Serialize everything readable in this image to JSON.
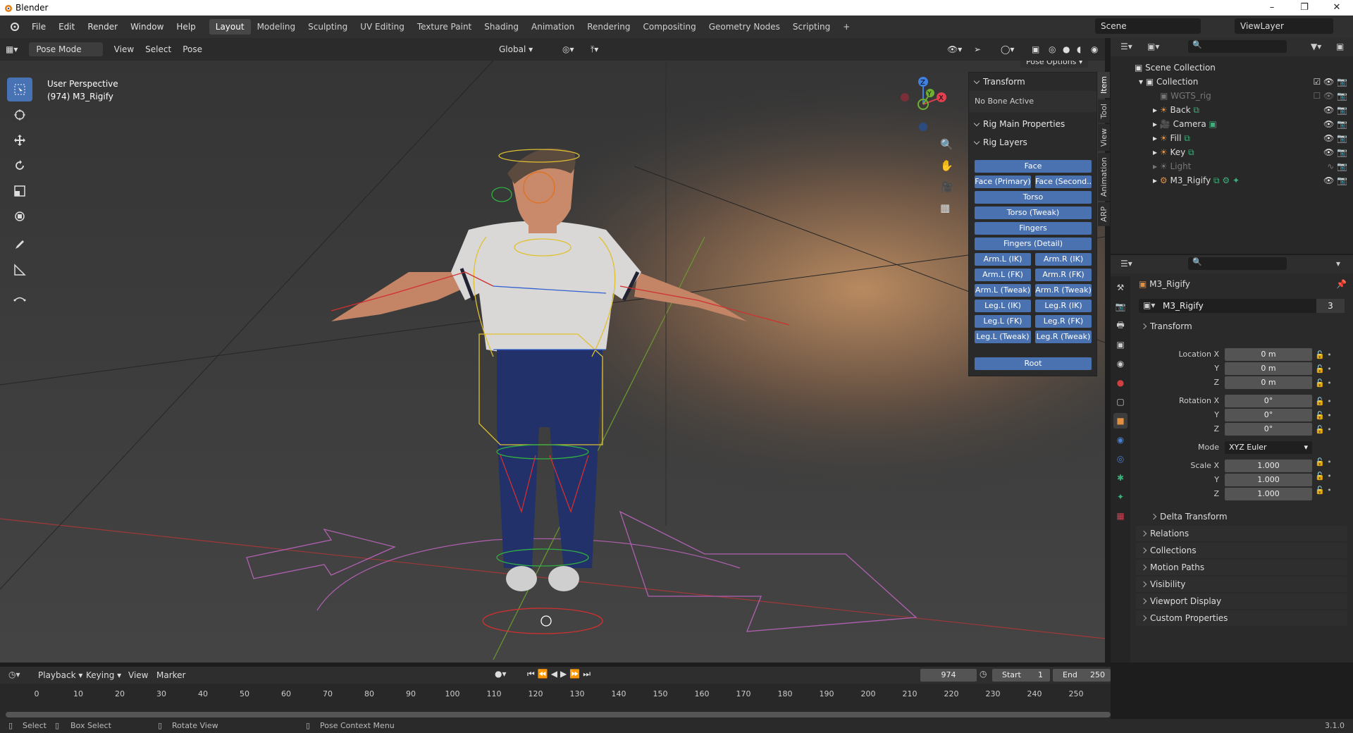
{
  "window": {
    "title": "Blender"
  },
  "topbar": {
    "menus": [
      "File",
      "Edit",
      "Render",
      "Window",
      "Help"
    ],
    "workspaces": [
      "Layout",
      "Modeling",
      "Sculpting",
      "UV Editing",
      "Texture Paint",
      "Shading",
      "Animation",
      "Rendering",
      "Compositing",
      "Geometry Nodes",
      "Scripting"
    ],
    "add_workspace": "+",
    "scene": "Scene",
    "view_layer": "ViewLayer"
  },
  "viewport_header": {
    "mode": "Pose Mode",
    "menus": [
      "View",
      "Select",
      "Pose"
    ],
    "orientation": "Global",
    "pose_options": "Pose Options"
  },
  "viewport": {
    "view_name": "User Perspective",
    "object_info": "(974) M3_Rigify",
    "gizmo_axes": [
      "X",
      "Y",
      "Z"
    ]
  },
  "npanel": {
    "tabs": [
      "Item",
      "Tool",
      "View",
      "Animation",
      "ARP"
    ],
    "transform": "Transform",
    "no_bone": "No Bone Active",
    "rig_main": "Rig Main Properties",
    "rig_layers": "Rig Layers",
    "layers": [
      "Face",
      "Face (Primary)",
      "Face (Second...",
      "Torso",
      "Torso (Tweak)",
      "Fingers",
      "Fingers (Detail)",
      "Arm.L (IK)",
      "Arm.R (IK)",
      "Arm.L (FK)",
      "Arm.R (FK)",
      "Arm.L (Tweak)",
      "Arm.R (Tweak)",
      "Leg.L (IK)",
      "Leg.R (IK)",
      "Leg.L (FK)",
      "Leg.R (FK)",
      "Leg.L (Tweak)",
      "Leg.R (Tweak)",
      "Root"
    ]
  },
  "outliner": {
    "root": "Scene Collection",
    "collection": "Collection",
    "items": [
      "WGTS_rig",
      "Back",
      "Camera",
      "Fill",
      "Key",
      "Light",
      "M3_Rigify"
    ]
  },
  "properties": {
    "object_name": "M3_Rigify",
    "datablock": "M3_Rigify",
    "users": "3",
    "transform_label": "Transform",
    "location_label": "Location X",
    "loc": [
      "0 m",
      "0 m",
      "0 m"
    ],
    "rotation_label": "Rotation X",
    "rot": [
      "0°",
      "0°",
      "0°"
    ],
    "axis_y": "Y",
    "axis_z": "Z",
    "mode_label": "Mode",
    "mode": "XYZ Euler",
    "scale_label": "Scale X",
    "scale": [
      "1.000",
      "1.000",
      "1.000"
    ],
    "delta": "Delta Transform",
    "sections": [
      "Relations",
      "Collections",
      "Motion Paths",
      "Visibility",
      "Viewport Display",
      "Custom Properties"
    ]
  },
  "timeline": {
    "menus": [
      "Playback",
      "Keying",
      "View",
      "Marker"
    ],
    "current_frame": "974",
    "start_label": "Start",
    "start": "1",
    "end_label": "End",
    "end": "250",
    "ticks": [
      "0",
      "10",
      "20",
      "30",
      "40",
      "50",
      "60",
      "70",
      "80",
      "90",
      "100",
      "110",
      "120",
      "130",
      "140",
      "150",
      "160",
      "170",
      "180",
      "190",
      "200",
      "210",
      "220",
      "230",
      "240",
      "250"
    ]
  },
  "statusbar": {
    "select": "Select",
    "box_select": "Box Select",
    "rotate_view": "Rotate View",
    "context_menu": "Pose Context Menu",
    "version": "3.1.0"
  },
  "colors": {
    "accent": "#4772b3",
    "bone_yellow": "#e0c030",
    "bone_green": "#30b040",
    "bone_red": "#d03030",
    "axis_x": "#e04050",
    "axis_y": "#70b030",
    "axis_z": "#3f80e0"
  }
}
